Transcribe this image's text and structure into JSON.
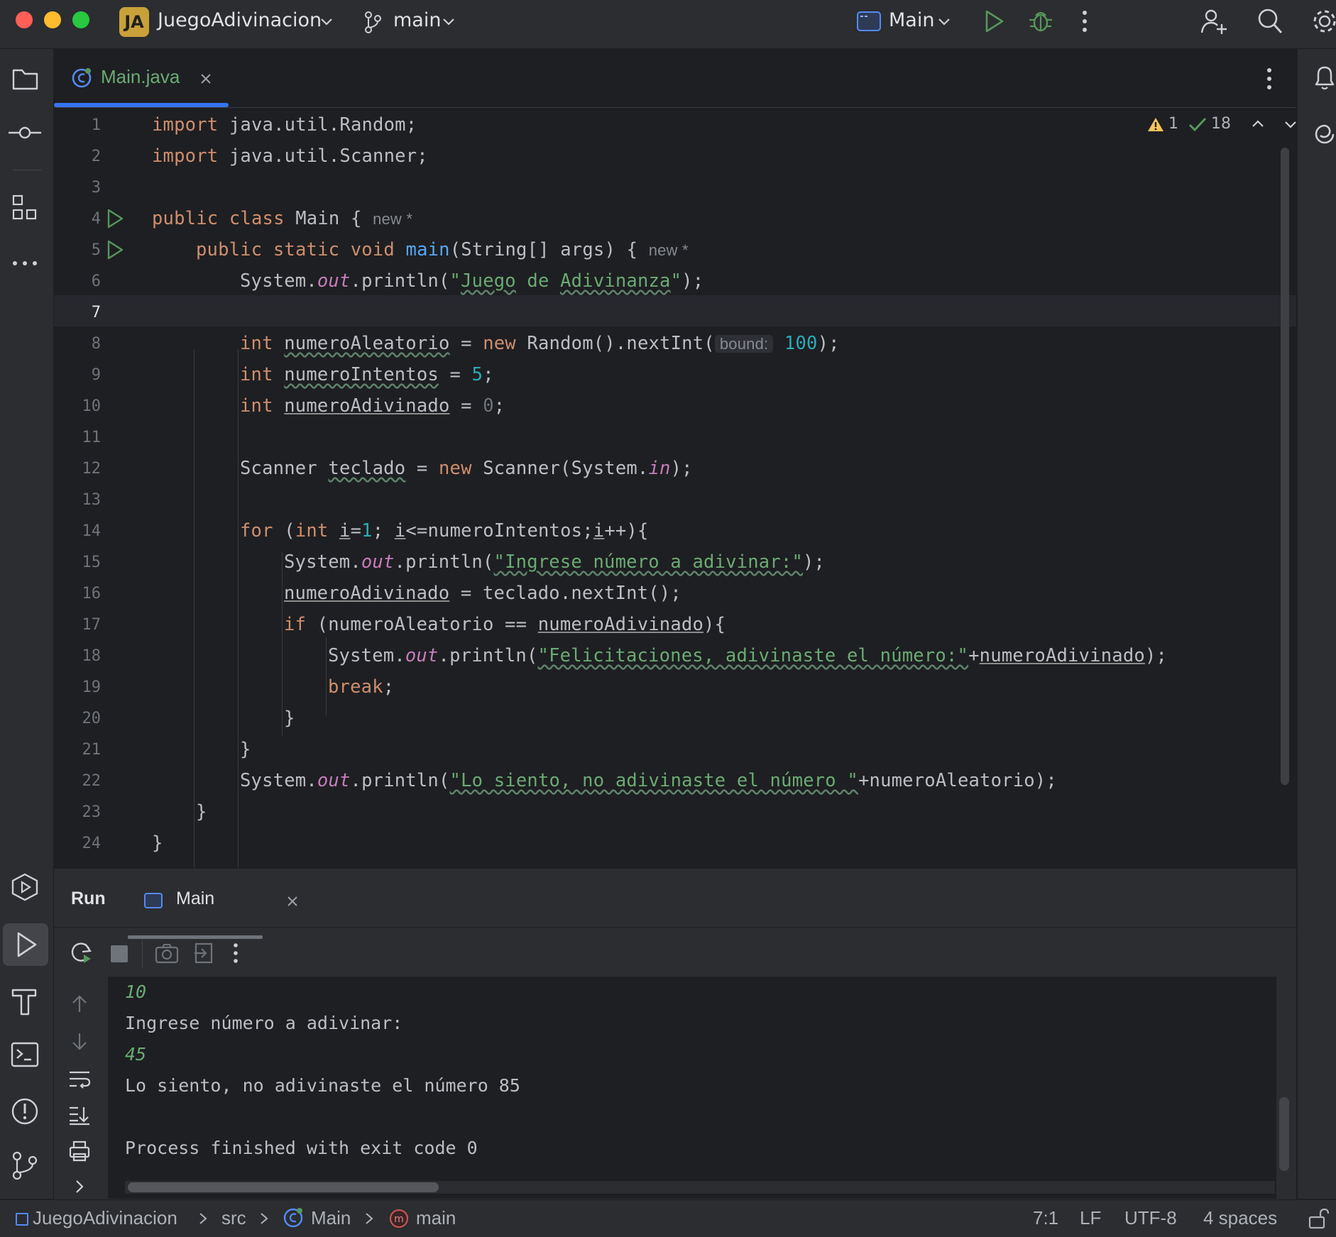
{
  "titlebar": {
    "project_badge": "JA",
    "project_name": "JuegoAdivinacion",
    "branch": "main",
    "run_config": "Main",
    "colors": {
      "close": "#ff5f57",
      "minimize": "#febc2e",
      "maximize": "#28c840",
      "badge": "#c9a13a"
    }
  },
  "tab": {
    "filename": "Main.java"
  },
  "inspections": {
    "warnings": "1",
    "ok": "18"
  },
  "editor": {
    "line_numbers": [
      "1",
      "2",
      "3",
      "4",
      "5",
      "6",
      "7",
      "8",
      "9",
      "10",
      "11",
      "12",
      "13",
      "14",
      "15",
      "16",
      "17",
      "18",
      "19",
      "20",
      "21",
      "22",
      "23",
      "24"
    ],
    "hint_new": "new *",
    "param_hint": "bound:",
    "l1_import": "import",
    "l1_rest": " java.util.Random;",
    "l2_import": "import",
    "l2_rest": " java.util.Scanner;",
    "l4_kw": "public class",
    "l4_rest": " Main { ",
    "l5_kw": "public static void",
    "l5_fn": "main",
    "l5_rest": "(String[] args) { ",
    "system": "System.",
    "out": "out",
    "println": ".println(",
    "l6_str_open": "\"",
    "l6_w1": "Juego",
    "l6_w2": " de ",
    "l6_w3": "Adivinanza",
    "l6_str_close": "\"",
    "l6_end": ");",
    "int": "int",
    "new": "new",
    "l8_var": "numeroAleatorio",
    "l8_mid": " = ",
    "l8_call": " Random().nextInt(",
    "l8_num": "100",
    "l8_end": ");",
    "l9_var": "numeroIntentos",
    "l9_mid": " = ",
    "l9_num": "5",
    "l9_end": ";",
    "l10_var": "numeroAdivinado",
    "l10_mid": " = ",
    "l10_num": "0",
    "l10_end": ";",
    "l12_type": "Scanner ",
    "l12_var": "teclado",
    "l12_mid": " = ",
    "l12_call": " Scanner(System.",
    "l12_in": "in",
    "l12_end": ");",
    "l14_for": "for",
    "l14_open": " (",
    "l14_i": "i",
    "l14_eq": "=",
    "l14_one": "1",
    "l14_semi": "; ",
    "l14_cond": "<=numeroIntentos;",
    "l14_inc": "++){",
    "l15_str": "\"Ingrese número a adivinar:\"",
    "l16_var": "numeroAdivinado",
    "l16_rest": " = teclado.nextInt();",
    "l17_if": "if",
    "l17_rest": " (numeroAleatorio == ",
    "l17_var": "numeroAdivinado",
    "l17_end": "){",
    "l18_str": "\"Felicitaciones, adivinaste el número:\"",
    "l18_plus": "+",
    "l18_var": "numeroAdivinado",
    "l18_end": ");",
    "l19_break": "break",
    "l19_end": ";",
    "brace": "}",
    "l22_str": "\"Lo siento, no adivinaste el número \"",
    "l22_rest": "+numeroAleatorio);"
  },
  "run": {
    "title": "Run",
    "tab": "Main",
    "output": [
      {
        "text": "10",
        "input": true
      },
      {
        "text": "Ingrese número a adivinar:",
        "input": false
      },
      {
        "text": "45",
        "input": true
      },
      {
        "text": "Lo siento, no adivinaste el número 85",
        "input": false
      },
      {
        "text": "",
        "input": false
      },
      {
        "text": "Process finished with exit code 0",
        "input": false
      }
    ]
  },
  "statusbar": {
    "project": "JuegoAdivinacion",
    "src": "src",
    "cls": "Main",
    "method": "main",
    "position": "7:1",
    "line_sep": "LF",
    "encoding": "UTF-8",
    "indent": "4 spaces"
  }
}
